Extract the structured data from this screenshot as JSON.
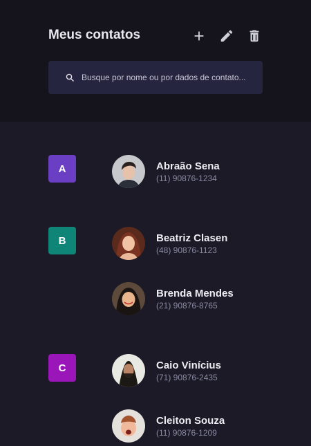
{
  "header": {
    "title": "Meus contatos",
    "actions": [
      {
        "name": "add-icon"
      },
      {
        "name": "edit-icon"
      },
      {
        "name": "delete-icon"
      }
    ]
  },
  "search": {
    "placeholder": "Busque por nome ou por dados de contato...",
    "value": ""
  },
  "groups": [
    {
      "letter": "A",
      "color": "#6a3fc4",
      "contacts": [
        {
          "name": "Abraão Sena",
          "phone": "(11) 90876-1234"
        }
      ]
    },
    {
      "letter": "B",
      "color": "#0f8577",
      "contacts": [
        {
          "name": "Beatriz Clasen",
          "phone": "(48) 90876-1123"
        },
        {
          "name": "Brenda Mendes",
          "phone": "(21) 90876-8765"
        }
      ]
    },
    {
      "letter": "C",
      "color": "#9a16b8",
      "contacts": [
        {
          "name": "Caio Vinícius",
          "phone": "(71) 90876-2435"
        },
        {
          "name": "Cleiton Souza",
          "phone": "(11) 90876-1209"
        }
      ]
    }
  ]
}
